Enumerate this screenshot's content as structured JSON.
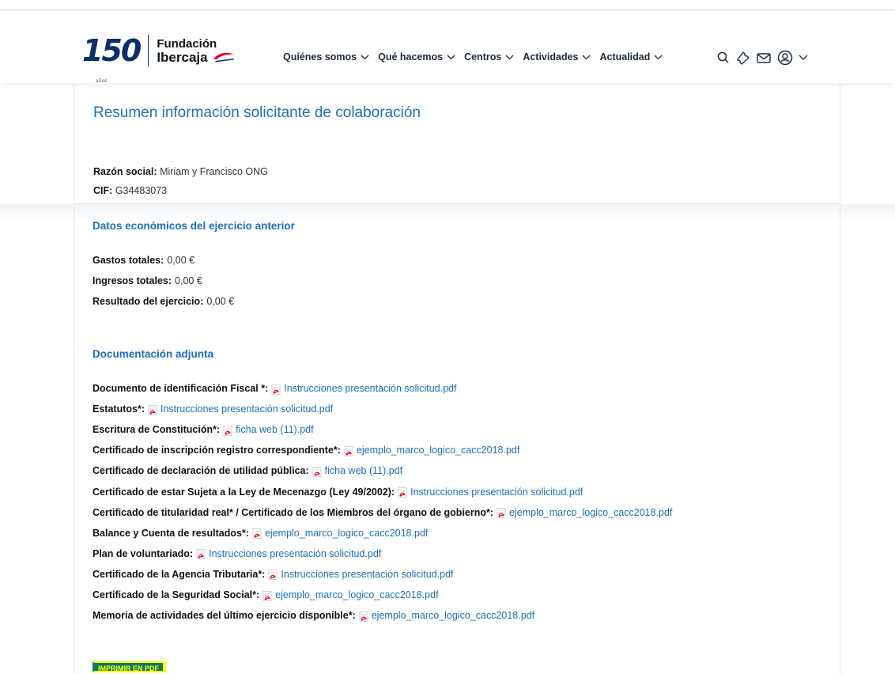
{
  "brand": {
    "anniversary": "150",
    "anniversary_sub": "años",
    "name_line1": "Fundación",
    "name_line2": "Ibercaja",
    "colors": {
      "navy": "#0b2f6b",
      "red": "#e3001b",
      "accent": "#1d6fb8"
    }
  },
  "nav": {
    "items": [
      {
        "label": "Quiénes somos"
      },
      {
        "label": "Qué hacemos"
      },
      {
        "label": "Centros"
      },
      {
        "label": "Actividades"
      },
      {
        "label": "Actualidad"
      }
    ]
  },
  "tools": {
    "icons": [
      "search-icon",
      "ticket-icon",
      "mail-icon",
      "user-icon",
      "chevron-down-icon"
    ]
  },
  "summary": {
    "title": "Resumen información solicitante de colaboración",
    "razon_social_label": "Razón social:",
    "razon_social_value": "Miriam y Francisco ONG",
    "cif_label": "CIF:",
    "cif_value": "G34483073"
  },
  "economic": {
    "title": "Datos económicos del ejercicio anterior",
    "rows": [
      {
        "label": "Gastos totales:",
        "value": "0,00 €"
      },
      {
        "label": "Ingresos totales:",
        "value": "0,00 €"
      },
      {
        "label": "Resultado del ejercicio:",
        "value": "0,00 €"
      }
    ]
  },
  "docs": {
    "title": "Documentación adjunta",
    "rows": [
      {
        "label": "Documento de identificación Fiscal *:",
        "file": "Instrucciones presentación solicitud.pdf"
      },
      {
        "label": "Estatutos*:",
        "file": "Instrucciones presentación solicitud.pdf"
      },
      {
        "label": "Escritura de Constitución*:",
        "file": "ficha web (11).pdf"
      },
      {
        "label": "Certificado de inscripción registro correspondiente*:",
        "file": "ejemplo_marco_logico_cacc2018.pdf"
      },
      {
        "label": "Certificado de declaración de utilidad pública:",
        "file": "ficha web (11).pdf"
      },
      {
        "label": "Certificado de estar Sujeta a la Ley de Mecenazgo (Ley 49/2002):",
        "file": "Instrucciones presentación solicitud.pdf"
      },
      {
        "label": "Certificado de titularidad real* / Certificado de los Miembros del órgano de gobierno*:",
        "file": "ejemplo_marco_logico_cacc2018.pdf"
      },
      {
        "label": "Balance y Cuenta de resultados*:",
        "file": "ejemplo_marco_logico_cacc2018.pdf"
      },
      {
        "label": "Plan de voluntariado:",
        "file": "Instrucciones presentación solicitud.pdf"
      },
      {
        "label": "Certificado de la Agencia Tributaria*:",
        "file": "Instrucciones presentación solicitud.pdf"
      },
      {
        "label": "Certificado de la Seguridad Social*:",
        "file": "ejemplo_marco_logico_cacc2018.pdf"
      },
      {
        "label": "Memoria de actividades del último ejercicio disponible*:",
        "file": "ejemplo_marco_logico_cacc2018.pdf"
      }
    ]
  },
  "print_button": {
    "label": "IMPRIMIR EN PDF",
    "bg": "#0a7b6a",
    "fg": "#ffff00"
  }
}
